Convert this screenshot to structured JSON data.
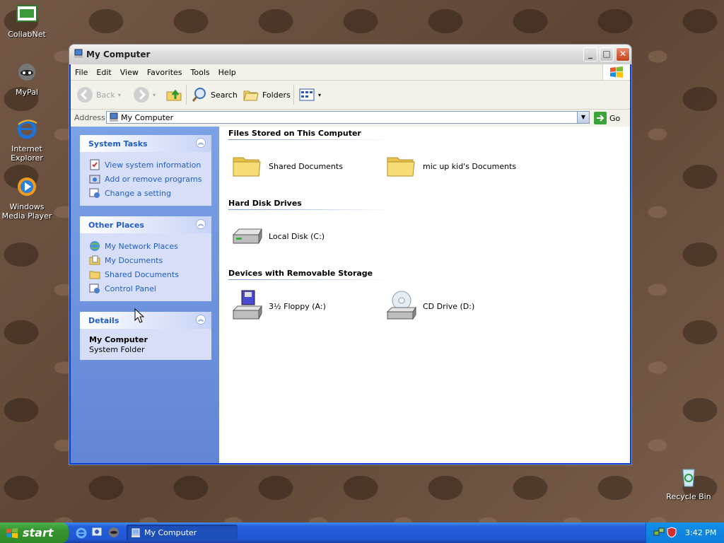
{
  "desktop": {
    "icons": [
      {
        "label": "CollabNet"
      },
      {
        "label": "MyPal"
      },
      {
        "label": "Internet Explorer"
      },
      {
        "label": "Windows Media Player"
      },
      {
        "label": "Recycle Bin"
      }
    ]
  },
  "window": {
    "title": "My Computer",
    "menu": [
      "File",
      "Edit",
      "View",
      "Favorites",
      "Tools",
      "Help"
    ],
    "toolbar": {
      "back": "Back",
      "search": "Search",
      "folders": "Folders"
    },
    "address": {
      "label": "Address",
      "value": "My Computer",
      "go": "Go"
    }
  },
  "tasks": {
    "system": {
      "title": "System Tasks",
      "items": [
        "View system information",
        "Add or remove programs",
        "Change a setting"
      ]
    },
    "other": {
      "title": "Other Places",
      "items": [
        "My Network Places",
        "My Documents",
        "Shared Documents",
        "Control Panel"
      ]
    },
    "details": {
      "title": "Details",
      "name": "My Computer",
      "type": "System Folder"
    }
  },
  "groups": [
    {
      "title": "Files Stored on This Computer",
      "items": [
        "Shared Documents",
        "mic up kid's Documents"
      ]
    },
    {
      "title": "Hard Disk Drives",
      "items": [
        "Local Disk (C:)"
      ]
    },
    {
      "title": "Devices with Removable Storage",
      "items": [
        "3½ Floppy (A:)",
        "CD Drive (D:)"
      ]
    }
  ],
  "taskbar": {
    "start": "start",
    "task": "My Computer",
    "clock": "3:42 PM"
  }
}
